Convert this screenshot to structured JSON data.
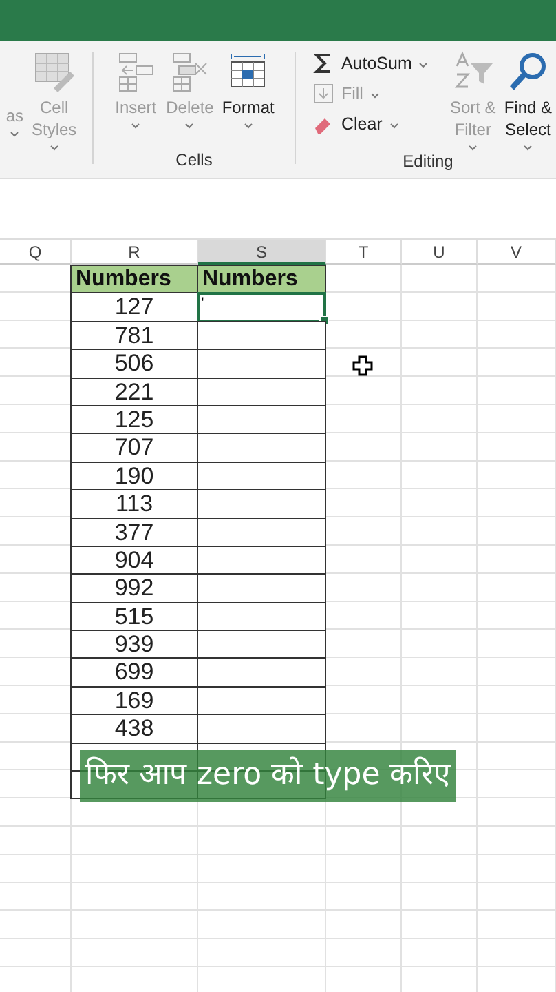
{
  "ribbon": {
    "groups": [
      {
        "items": [
          {
            "kind": "partial",
            "lines": [
              "as"
            ],
            "disabled": true
          },
          {
            "kind": "styles",
            "lines": [
              "Cell",
              "Styles"
            ],
            "disabled": true
          }
        ]
      },
      {
        "label": "Cells",
        "items": [
          {
            "kind": "insert",
            "lines": [
              "Insert"
            ],
            "disabled": true
          },
          {
            "kind": "delete",
            "lines": [
              "Delete"
            ],
            "disabled": true
          },
          {
            "kind": "format",
            "lines": [
              "Format"
            ],
            "disabled": false
          }
        ]
      },
      {
        "label": "Editing",
        "small": [
          {
            "kind": "autosum",
            "label": "AutoSum",
            "disabled": false
          },
          {
            "kind": "fill",
            "label": "Fill",
            "disabled": true
          },
          {
            "kind": "clear",
            "label": "Clear",
            "disabled": false
          }
        ],
        "items": [
          {
            "kind": "sort",
            "lines": [
              "Sort &",
              "Filter"
            ],
            "disabled": true
          },
          {
            "kind": "find",
            "lines": [
              "Find &",
              "Select"
            ],
            "disabled": false
          }
        ]
      }
    ]
  },
  "sheet": {
    "columns": [
      {
        "label": "Q",
        "selected": false
      },
      {
        "label": "R",
        "selected": false
      },
      {
        "label": "S",
        "selected": true
      },
      {
        "label": "T",
        "selected": false
      },
      {
        "label": "U",
        "selected": false
      },
      {
        "label": "V",
        "selected": false
      }
    ],
    "header": [
      "Numbers",
      "Numbers"
    ],
    "rows": [
      {
        "r": "127",
        "s": "'",
        "selected": true
      },
      {
        "r": "781",
        "selected": false
      },
      {
        "r": "506",
        "selected": false
      },
      {
        "r": "221",
        "selected": false
      },
      {
        "r": "125",
        "selected": false
      },
      {
        "r": "707",
        "selected": false
      },
      {
        "r": "190",
        "selected": false
      },
      {
        "r": "113",
        "selected": false
      },
      {
        "r": "377",
        "selected": false
      },
      {
        "r": "904",
        "selected": false
      },
      {
        "r": "992",
        "selected": false
      },
      {
        "r": "515",
        "selected": false
      },
      {
        "r": "939",
        "selected": false
      },
      {
        "r": "699",
        "selected": false
      },
      {
        "r": "169",
        "selected": false
      },
      {
        "r": "438",
        "selected": false
      }
    ]
  },
  "caption": "फिर आप zero को type करिए"
}
